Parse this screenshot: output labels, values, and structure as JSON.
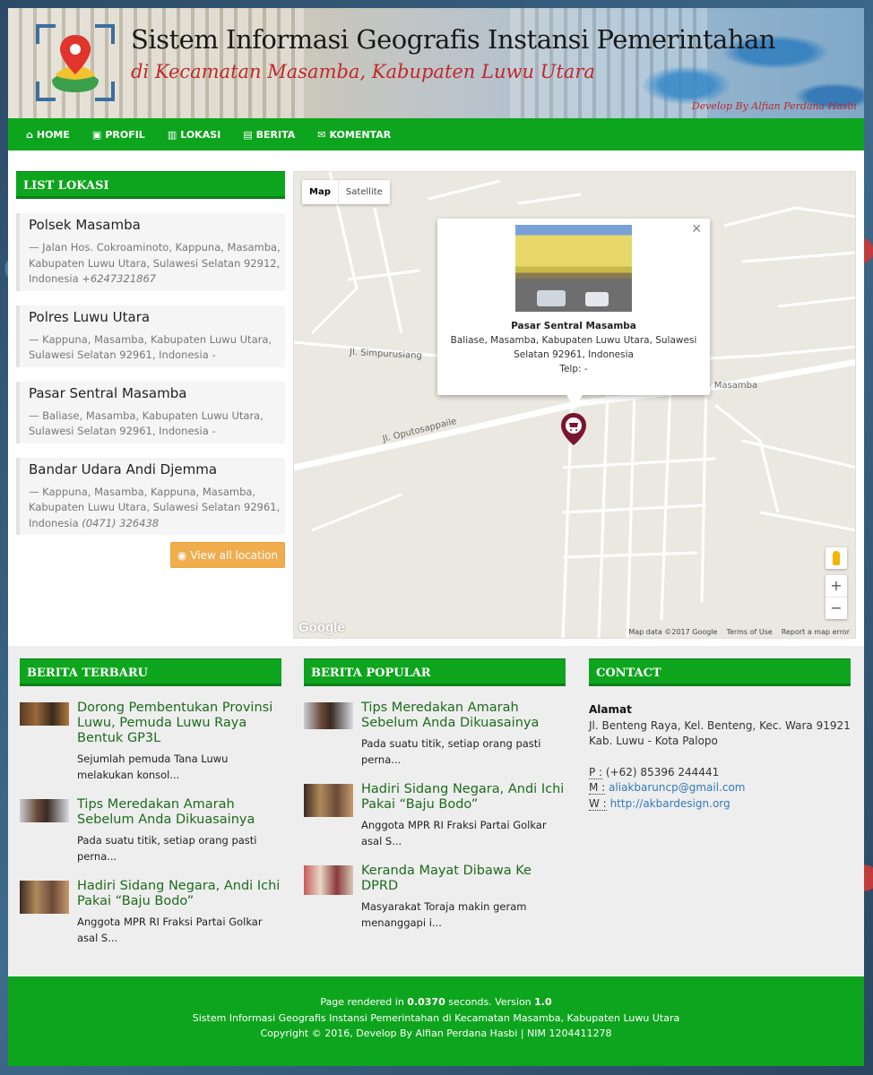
{
  "header": {
    "title": "Sistem Informasi Geografis Instansi Pemerintahan",
    "subtitle": "di Kecamatan Masamba, Kabupaten Luwu Utara",
    "developer": "Develop By Alfian Perdana Hasbi"
  },
  "nav": {
    "items": [
      {
        "label": "HOME",
        "icon": "home-icon"
      },
      {
        "label": "PROFIL",
        "icon": "briefcase-icon"
      },
      {
        "label": "LOKASI",
        "icon": "map-icon"
      },
      {
        "label": "BERITA",
        "icon": "newspaper-icon"
      },
      {
        "label": "KOMENTAR",
        "icon": "comments-icon"
      }
    ]
  },
  "list_lokasi": {
    "heading": "LIST LOKASI",
    "items": [
      {
        "name": "Polsek Masamba",
        "address": "— Jalan Hos. Cokroaminoto, Kappuna, Masamba, Kabupaten Luwu Utara, Sulawesi Selatan 92912, Indonesia",
        "phone": "+6247321867"
      },
      {
        "name": "Polres Luwu Utara",
        "address": "— Kappuna, Masamba, Kabupaten Luwu Utara, Sulawesi Selatan 92961, Indonesia",
        "phone": "-"
      },
      {
        "name": "Pasar Sentral Masamba",
        "address": "— Baliase, Masamba, Kabupaten Luwu Utara, Sulawesi Selatan 92961, Indonesia",
        "phone": "-"
      },
      {
        "name": "Bandar Udara Andi Djemma",
        "address": "— Kappuna, Masamba, Kappuna, Masamba, Kabupaten Luwu Utara, Sulawesi Selatan 92961, Indonesia",
        "phone": "(0471) 326438"
      }
    ],
    "view_all": "View all location"
  },
  "map": {
    "type_map": "Map",
    "type_satellite": "Satellite",
    "info_title": "Pasar Sentral Masamba",
    "info_address": "Baliase, Masamba, Kabupaten Luwu Utara, Sulawesi Selatan 92961, Indonesia",
    "info_phone": "Telp: -",
    "road_1": "Jl. Simpurusiang",
    "road_2": "Jl. Oputosappaile",
    "road_3": "- Masamba",
    "google": "Google",
    "data_label": "Map data ©2017 Google",
    "terms": "Terms of Use",
    "report": "Report a map error",
    "zoom_in": "+",
    "zoom_out": "−"
  },
  "berita_terbaru": {
    "heading": "BERITA TERBARU",
    "items": [
      {
        "title": "Dorong Pembentukan Provinsi Luwu, Pemuda Luwu Raya Bentuk GP3L",
        "excerpt": "Sejumlah pemuda Tana Luwu melakukan konsol..."
      },
      {
        "title": "Tips Meredakan Amarah Sebelum Anda Dikuasainya",
        "excerpt": "Pada suatu titik, setiap orang pasti perna..."
      },
      {
        "title": "Hadiri Sidang Negara, Andi Ichi Pakai “Baju Bodo”",
        "excerpt": "Anggota MPR RI Fraksi Partai Golkar asal S..."
      }
    ]
  },
  "berita_popular": {
    "heading": "BERITA POPULAR",
    "items": [
      {
        "title": "Tips Meredakan Amarah Sebelum Anda Dikuasainya",
        "excerpt": "Pada suatu titik, setiap orang pasti perna..."
      },
      {
        "title": "Hadiri Sidang Negara, Andi Ichi Pakai “Baju Bodo”",
        "excerpt": "Anggota MPR RI Fraksi Partai Golkar asal S..."
      },
      {
        "title": "Keranda Mayat Dibawa Ke DPRD",
        "excerpt": "Masyarakat Toraja makin geram menanggapi i..."
      }
    ]
  },
  "contact": {
    "heading": "CONTACT",
    "alamat_label": "Alamat",
    "alamat": "Jl. Benteng Raya, Kel. Benteng, Kec. Wara 91921 Kab. Luwu - Kota Palopo",
    "phone_label": "P :",
    "phone": "(+62) 85396 244441",
    "mail_label": "M :",
    "mail": "aliakbaruncp@gmail.com",
    "web_label": "W :",
    "web": "http://akbardesign.org"
  },
  "footer": {
    "rendered_prefix": "Page rendered in",
    "rendered_time": "0.0370",
    "rendered_mid": "seconds. Version",
    "version": "1.0",
    "line2": "Sistem Informasi Geografis Instansi Pemerintahan di Kecamatan Masamba, Kabupaten Luwu Utara",
    "line3": "Copyright © 2016, Develop By Alfian Perdana Hasbi | NIM 1204411278"
  },
  "colors": {
    "nav_green": "#0ea51e",
    "title_red": "#c0282d",
    "button_orange": "#f0ad4e",
    "link_blue": "#337ab7"
  }
}
